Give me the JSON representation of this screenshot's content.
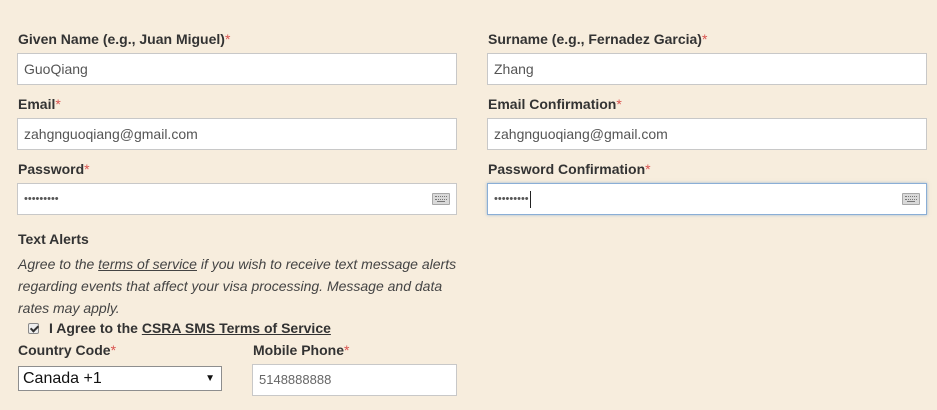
{
  "given_name": {
    "label": "Given Name (e.g., Juan Miguel)",
    "required": "*",
    "value": "GuoQiang"
  },
  "surname": {
    "label": "Surname (e.g., Fernadez Garcia)",
    "required": "*",
    "value": "Zhang"
  },
  "email": {
    "label": "Email",
    "required": "*",
    "value": "zahgnguoqiang@gmail.com"
  },
  "email_confirmation": {
    "label": "Email Confirmation",
    "required": "*",
    "value": "zahgnguoqiang@gmail.com"
  },
  "password": {
    "label": "Password",
    "required": "*",
    "value": "•••••••••"
  },
  "password_confirmation": {
    "label": "Password Confirmation",
    "required": "*",
    "value": "•••••••••"
  },
  "text_alerts": {
    "title": "Text Alerts",
    "desc_prefix": "Agree to the ",
    "desc_link": "terms of service",
    "desc_suffix": " if you wish to receive text message alerts regarding events that affect your visa processing. Message and data rates may apply.",
    "agree_prefix": "I Agree to the ",
    "agree_link": "CSRA SMS Terms of Service",
    "agree_checked": true
  },
  "country_code": {
    "label": "Country Code",
    "required": "*",
    "selected": "Canada +1"
  },
  "mobile_phone": {
    "label": "Mobile Phone",
    "required": "*",
    "value": "5148888888"
  }
}
